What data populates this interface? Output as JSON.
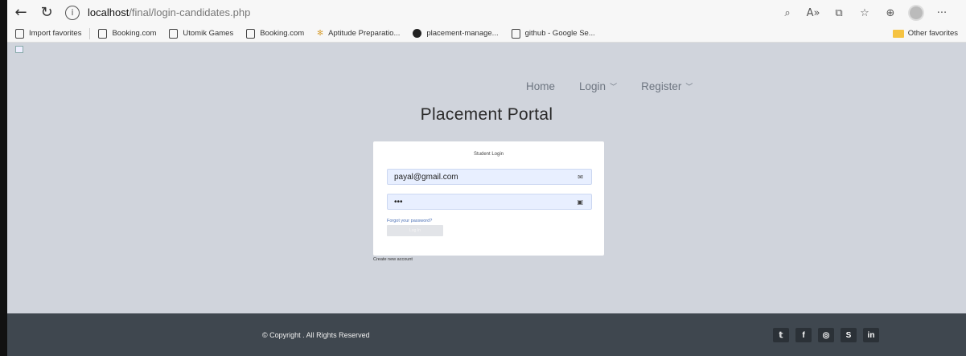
{
  "browser": {
    "url_host": "localhost",
    "url_path": "/final/login-candidates.php",
    "favorites": [
      {
        "label": "Import favorites"
      },
      {
        "label": "Booking.com"
      },
      {
        "label": "Utomik Games"
      },
      {
        "label": "Booking.com"
      },
      {
        "label": "Aptitude Preparatio..."
      },
      {
        "label": "placement-manage..."
      },
      {
        "label": "github - Google Se..."
      }
    ],
    "other_favorites": "Other favorites"
  },
  "nav": {
    "home": "Home",
    "login": "Login",
    "register": "Register"
  },
  "page_title": "Placement Portal",
  "login": {
    "title": "Student Login",
    "email_value": "payal@gmail.com",
    "password_value": "•••",
    "forgot": "Forgot your password?",
    "button": "Log In",
    "create_account": "Create new account"
  },
  "footer": {
    "copyright": "© Copyright . All Rights Reserved",
    "socials": [
      "twitter-icon",
      "facebook-icon",
      "instagram-icon",
      "skype-icon",
      "linkedin-icon"
    ]
  },
  "colors": {
    "page_bg": "#d0d4dc",
    "footer_bg": "#3f474f",
    "field_bg": "#e8efff"
  }
}
